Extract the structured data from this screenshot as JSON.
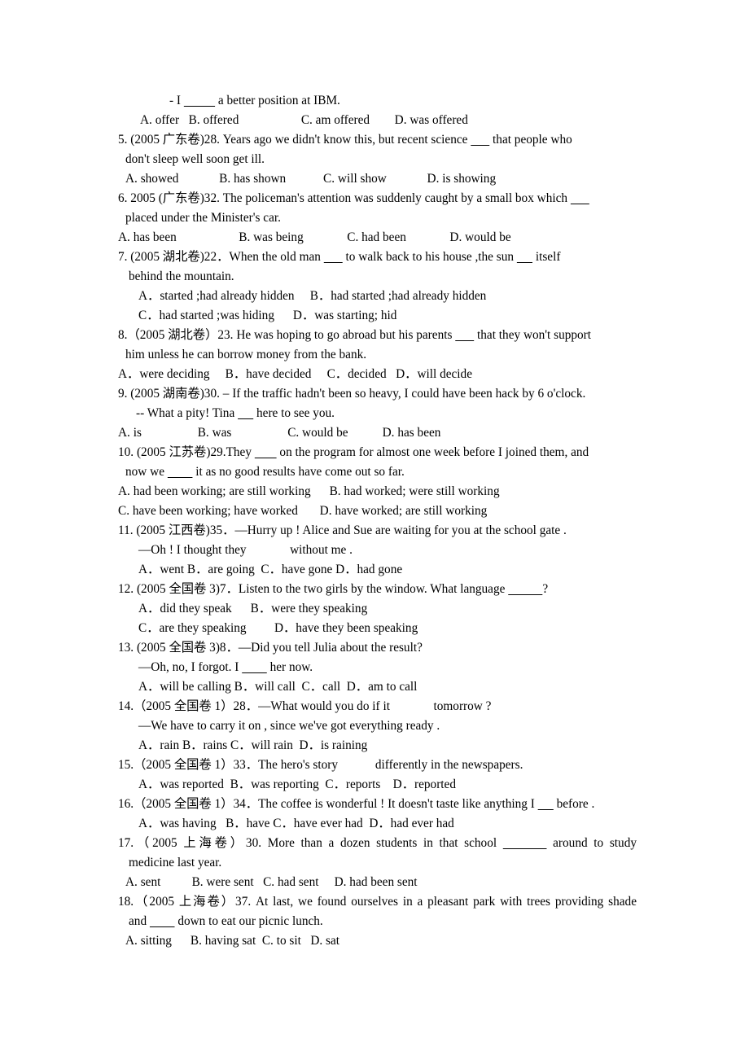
{
  "document": {
    "type": "exam-worksheet",
    "subject": "English grammar multiple-choice questions (verb tenses / voice)",
    "page_background": "#ffffff",
    "text_color": "#000000"
  },
  "lines": [
    {
      "id": "l01",
      "indent": "i-first",
      "text": "- I __________ a better position at IBM."
    },
    {
      "id": "l02",
      "indent": "i-firstopt",
      "text": "A. offer   B. offered                    C. am offered        D. was offered"
    },
    {
      "id": "l03",
      "indent": "i-num",
      "text": "5. (2005 广东卷)28. Years ago we didn't know this, but recent science ______ that people who"
    },
    {
      "id": "l04",
      "indent": "i-cont",
      "text": "don't sleep well soon get ill."
    },
    {
      "id": "l05",
      "indent": "i-opt",
      "text": "A. showed             B. has shown            C. will show             D. is showing"
    },
    {
      "id": "l06",
      "indent": "i-num",
      "text": "6. 2005 (广东卷)32. The policeman's attention was suddenly caught by a small box which ______"
    },
    {
      "id": "l07",
      "indent": "i-cont",
      "text": "placed under the Minister's car."
    },
    {
      "id": "l08",
      "indent": "i-num",
      "text": "A. has been                    B. was being              C. had been              D. would be"
    },
    {
      "id": "l09",
      "indent": "i-num",
      "text": "7. (2005 湖北卷)22．When the old man ______ to walk back to his house ,the sun _____ itself"
    },
    {
      "id": "l10",
      "indent": "i-cont2",
      "text": "behind the mountain."
    },
    {
      "id": "l11",
      "indent": "i-opt2",
      "text": "A．started ;had already hidden     B．had started ;had already hidden"
    },
    {
      "id": "l12",
      "indent": "i-opt2",
      "text": "C．had started ;was hiding      D．was starting; hid"
    },
    {
      "id": "l13",
      "indent": "i-num",
      "text": "8.（2005 湖北卷）23. He was hoping to go abroad but his parents ______ that they won't support"
    },
    {
      "id": "l14",
      "indent": "i-cont",
      "text": "him unless he can borrow money from the bank."
    },
    {
      "id": "l15",
      "indent": "i-num",
      "text": "A．were deciding     B．have decided     C．decided   D．will decide"
    },
    {
      "id": "l16",
      "indent": "i-num",
      "text": "9. (2005 湖南卷)30. – If the traffic hadn't been so heavy, I could have been hack by 6 o'clock."
    },
    {
      "id": "l17",
      "indent": "i-dash",
      "text": "-- What a pity! Tina _____ here to see you."
    },
    {
      "id": "l18",
      "indent": "i-num",
      "text": "A. is                  B. was                  C. would be           D. has been"
    },
    {
      "id": "l19",
      "indent": "i-num",
      "text": "10. (2005 江苏卷)29.They _______ on the program for almost one week before I joined them, and"
    },
    {
      "id": "l20",
      "indent": "i-cont",
      "text": "now we ________ it as no good results have come out so far."
    },
    {
      "id": "l21",
      "indent": "i-num",
      "text": "A. had been working; are still working      B. had worked; were still working"
    },
    {
      "id": "l22",
      "indent": "i-num",
      "text": "C. have been working; have worked       D. have worked; are still working"
    },
    {
      "id": "l23",
      "indent": "i-num",
      "text": "11. (2005 江西卷)35．—Hurry up ! Alice and Sue are waiting for you at the school gate ."
    },
    {
      "id": "l24",
      "indent": "i-opt2",
      "text": "—Oh ! I thought they              without me ."
    },
    {
      "id": "l25",
      "indent": "i-opt2",
      "text": "A．went B．are going  C．have gone D．had gone"
    },
    {
      "id": "l26",
      "indent": "i-num",
      "text": "12. (2005 全国卷 3)7．Listen to the two girls by the window. What language ___________?"
    },
    {
      "id": "l27",
      "indent": "i-opt2",
      "text": "A．did they speak      B．were they speaking"
    },
    {
      "id": "l28",
      "indent": "i-opt2",
      "text": "C．are they speaking         D．have they been speaking"
    },
    {
      "id": "l29",
      "indent": "i-num",
      "text": "13. (2005 全国卷 3)8．—Did you tell Julia about the result?"
    },
    {
      "id": "l30",
      "indent": "i-opt2",
      "text": "—Oh, no, I forgot. I ________ her now."
    },
    {
      "id": "l31",
      "indent": "i-opt2",
      "text": "A．will be calling B．will call  C．call  D．am to call"
    },
    {
      "id": "l32",
      "indent": "i-num",
      "text": "14.（2005 全国卷 1）28．—What would you do if it              tomorrow ?"
    },
    {
      "id": "l33",
      "indent": "i-opt2",
      "text": "—We have to carry it on , since we've got everything ready ."
    },
    {
      "id": "l34",
      "indent": "i-opt2",
      "text": "A．rain B．rains C．will rain  D．is raining"
    },
    {
      "id": "l35",
      "indent": "i-num",
      "text": "15.（2005 全国卷 1）33．The hero's story            differently in the newspapers."
    },
    {
      "id": "l36",
      "indent": "i-opt2",
      "text": "A．was reported  B．was reporting  C．reports    D．reported"
    },
    {
      "id": "l37",
      "indent": "i-num",
      "text": "16.（2005 全国卷 1）34．The coffee is wonderful ! It doesn't taste like anything I _____ before ."
    },
    {
      "id": "l38",
      "indent": "i-opt2",
      "text": "A．was having   B．have C．have ever had  D．had ever had"
    },
    {
      "id": "l39",
      "indent": "i-num",
      "text": "17.（2005 上海卷）30. More than a dozen students in that school _______ around to study",
      "justify": true
    },
    {
      "id": "l40",
      "indent": "i-cont2",
      "text": "medicine last year."
    },
    {
      "id": "l41",
      "indent": "i-opt",
      "text": "A. sent          B. were sent   C. had sent     D. had been sent"
    },
    {
      "id": "l42",
      "indent": "i-num",
      "text": "18.（2005 上海卷）37. At last, we found ourselves in a pleasant park with trees providing shade",
      "justify": true
    },
    {
      "id": "l43",
      "indent": "i-cont2",
      "text": "and ________ down to eat our picnic lunch."
    },
    {
      "id": "l44",
      "indent": "i-opt",
      "text": "A. sitting      B. having sat  C. to sit   D. sat"
    }
  ]
}
